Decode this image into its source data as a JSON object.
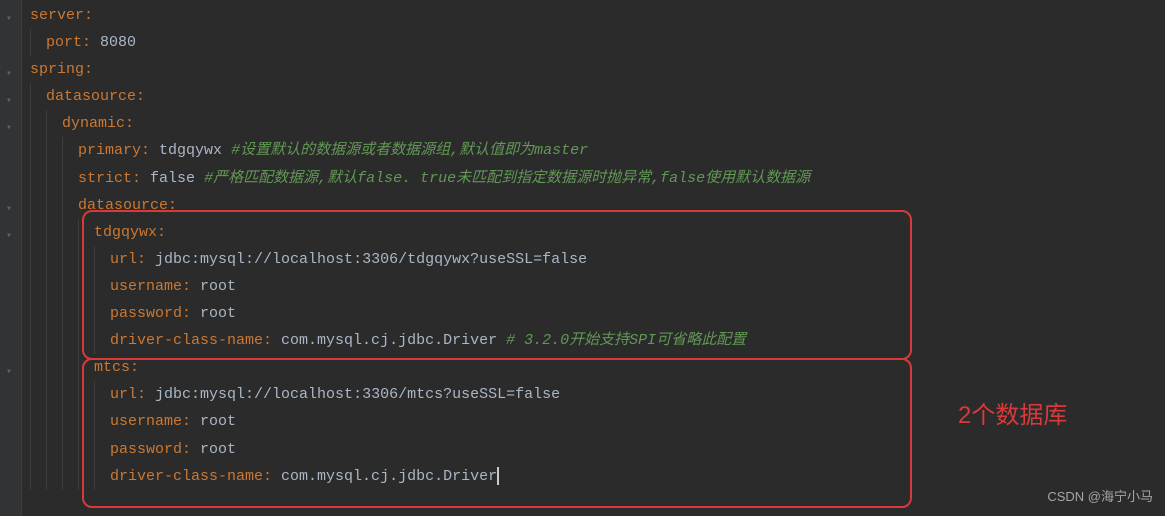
{
  "yaml": {
    "server": {
      "key": "server",
      "port_key": "port",
      "port_val": "8080"
    },
    "spring": {
      "key": "spring",
      "datasource": {
        "key": "datasource",
        "dynamic": {
          "key": "dynamic",
          "primary": {
            "key": "primary",
            "val": "tdgqywx",
            "comment": "#设置默认的数据源或者数据源组,默认值即为master"
          },
          "strict": {
            "key": "strict",
            "val": "false",
            "comment": "#严格匹配数据源,默认false. true未匹配到指定数据源时抛异常,false使用默认数据源"
          },
          "datasource": {
            "key": "datasource",
            "tdgqywx": {
              "name": "tdgqywx",
              "url_key": "url",
              "url_val": "jdbc:mysql://localhost:3306/tdgqywx?useSSL=false",
              "user_key": "username",
              "user_val": "root",
              "pass_key": "password",
              "pass_val": "root",
              "driver_key": "driver-class-name",
              "driver_val": "com.mysql.cj.jdbc.Driver",
              "driver_comment": "# 3.2.0开始支持SPI可省略此配置"
            },
            "mtcs": {
              "name": "mtcs",
              "url_key": "url",
              "url_val": "jdbc:mysql://localhost:3306/mtcs?useSSL=false",
              "user_key": "username",
              "user_val": "root",
              "pass_key": "password",
              "pass_val": "root",
              "driver_key": "driver-class-name",
              "driver_val": "com.mysql.cj.jdbc.Driver"
            }
          }
        }
      }
    }
  },
  "annotation": "2个数据库",
  "watermark": "CSDN @海宁小马",
  "colors": {
    "key": "#cc7832",
    "comment": "#629755",
    "border": "#d73a3a",
    "bg": "#2b2b2b"
  }
}
